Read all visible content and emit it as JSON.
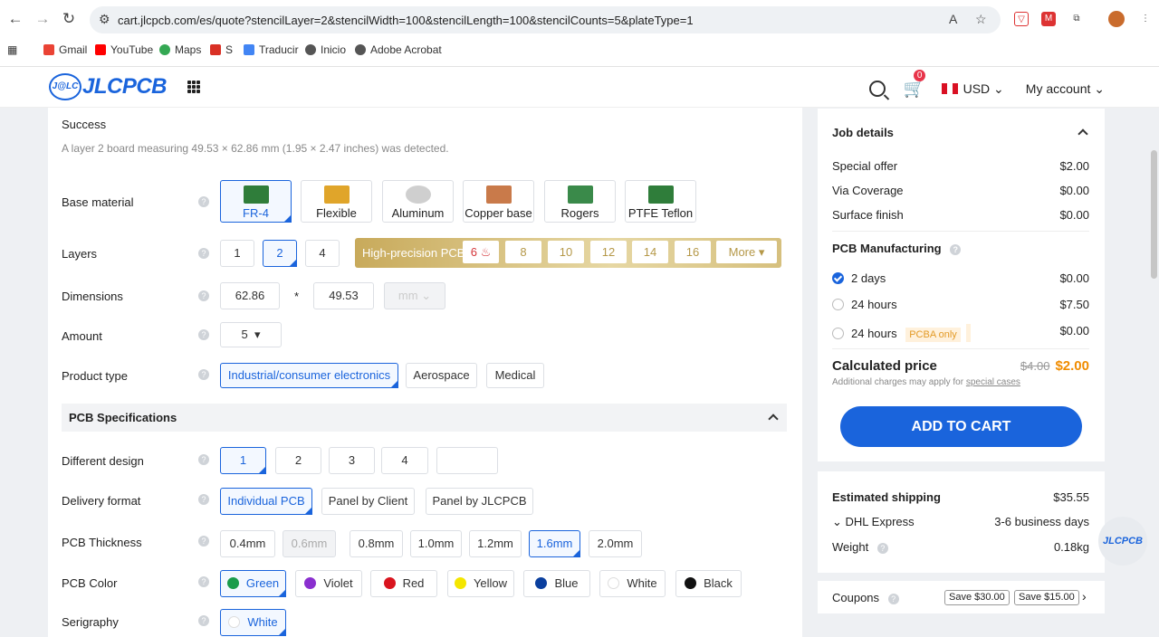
{
  "browser": {
    "url": "cart.jlcpcb.com/es/quote?stencilLayer=2&stencilWidth=100&stencilLength=100&stencilCounts=5&plateType=1",
    "bookmarks": [
      "Gmail",
      "YouTube",
      "Maps",
      "S",
      "Traducir",
      "Inicio",
      "Adobe Acrobat"
    ]
  },
  "header": {
    "logo_mark": "J@LC",
    "logo_text": "JLCPCB",
    "cart_count": "0",
    "currency": "USD",
    "account": "My account"
  },
  "detect": {
    "title": "Success",
    "message": "A layer 2 board measuring 49.53 × 62.86 mm (1.95 × 2.47 inches) was detected."
  },
  "form": {
    "base_material_label": "Base material",
    "materials": [
      "FR-4",
      "Flexible",
      "Aluminum",
      "Copper base",
      "Rogers",
      "PTFE Teflon"
    ],
    "layers_label": "Layers",
    "layers": [
      "1",
      "2",
      "4"
    ],
    "hp_title": "High-precision PCB",
    "hp_layers": [
      "6",
      "8",
      "10",
      "12",
      "14",
      "16"
    ],
    "hp_more": "More",
    "dimensions_label": "Dimensions",
    "dim_x": "62.86",
    "dim_times": "*",
    "dim_y": "49.53",
    "dim_unit": "mm",
    "amount_label": "Amount",
    "amount": "5",
    "product_type_label": "Product type",
    "product_types": [
      "Industrial/consumer electronics",
      "Aerospace",
      "Medical"
    ],
    "spec_title": "PCB Specifications",
    "design_label": "Different design",
    "designs": [
      "1",
      "2",
      "3",
      "4"
    ],
    "delivery_label": "Delivery format",
    "deliveries": [
      "Individual PCB",
      "Panel by Client",
      "Panel by JLCPCB"
    ],
    "thickness_label": "PCB Thickness",
    "thicknesses": [
      "0.4mm",
      "0.6mm",
      "0.8mm",
      "1.0mm",
      "1.2mm",
      "1.6mm",
      "2.0mm"
    ],
    "color_label": "PCB Color",
    "colors": [
      "Green",
      "Violet",
      "Red",
      "Yellow",
      "Blue",
      "White",
      "Black"
    ],
    "color_hex": [
      "#1a9b4b",
      "#8a2fcf",
      "#d9141e",
      "#f4e600",
      "#0b3f9e",
      "#ffffff",
      "#111111"
    ],
    "serigraphy_label": "Serigraphy",
    "serigraphy": "White"
  },
  "summary": {
    "job_details": "Job details",
    "rows": [
      {
        "label": "Special offer",
        "value": "$2.00"
      },
      {
        "label": "Via Coverage",
        "value": "$0.00"
      },
      {
        "label": "Surface finish",
        "value": "$0.00"
      }
    ],
    "manufacturing": "PCB Manufacturing",
    "options": [
      {
        "label": "2 days",
        "value": "$0.00"
      },
      {
        "label": "24 hours",
        "value": "$7.50"
      },
      {
        "label": "24 hours",
        "value": "$0.00",
        "badge": "PCBA only"
      }
    ],
    "calc_label": "Calculated price",
    "old_price": "$4.00",
    "price": "$2.00",
    "note": "Additional charges may apply for",
    "note_link": "special cases",
    "add_to_cart": "ADD TO CART"
  },
  "shipping": {
    "title": "Estimated shipping",
    "cost": "$35.55",
    "carrier": "DHL Express",
    "days": "3-6 business days",
    "weight_label": "Weight",
    "weight": "0.18kg"
  },
  "coupons": {
    "label": "Coupons",
    "items": [
      "Save $30.00",
      "Save $15.00"
    ]
  },
  "float_logo": "JLCPCB"
}
